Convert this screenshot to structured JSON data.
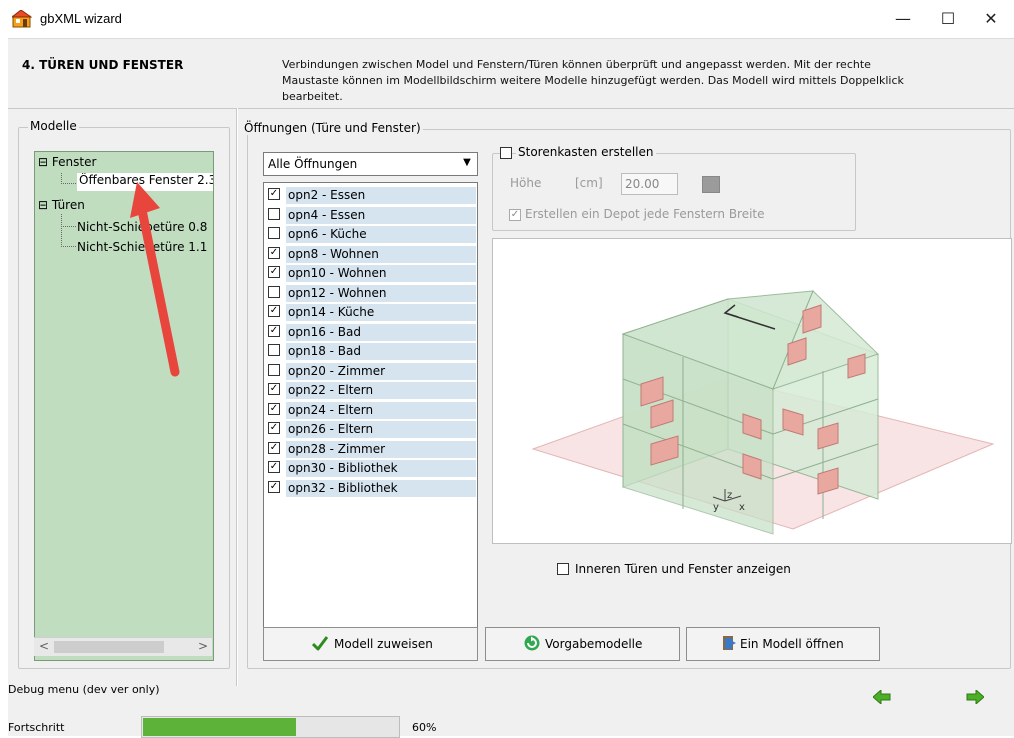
{
  "window": {
    "title": "gbXML wizard",
    "controls": {
      "minimize": "—",
      "maximize": "☐",
      "close": "✕"
    }
  },
  "step": {
    "title": "4.  TÜREN UND FENSTER",
    "description": "Verbindungen zwischen Model und Fenstern/Türen können überprüft und angepasst werden. Mit der rechte Maustaste können im Modellbildschirm weitere Modelle hinzugefügt werden. Das Modell wird mittels Doppelklick bearbeitet."
  },
  "modelle": {
    "label": "Modelle",
    "tree": [
      {
        "label": "Fenster",
        "expander": "⊟",
        "level": 0
      },
      {
        "label": "Öffenbares Fenster 2.3",
        "level": 1,
        "selected": true
      },
      {
        "label": "Türen",
        "expander": "⊟",
        "level": 0
      },
      {
        "label": "Nicht-Schiebetüre 0.8",
        "level": 1
      },
      {
        "label": "Nicht-Schiebetüre 1.1",
        "level": 1
      }
    ],
    "scroll_left": "<",
    "scroll_right": ">"
  },
  "oeffnungen": {
    "label": "Öffnungen (Türe und Fenster)",
    "filter": {
      "selected": "Alle Öffnungen"
    },
    "items": [
      {
        "label": "opn2 - Essen",
        "checked": true
      },
      {
        "label": "opn4 - Essen",
        "checked": false
      },
      {
        "label": "opn6 - Küche",
        "checked": false
      },
      {
        "label": "opn8 - Wohnen",
        "checked": true
      },
      {
        "label": "opn10 - Wohnen",
        "checked": true
      },
      {
        "label": "opn12 - Wohnen",
        "checked": false
      },
      {
        "label": "opn14 - Küche",
        "checked": true
      },
      {
        "label": "opn16 - Bad",
        "checked": true
      },
      {
        "label": "opn18 - Bad",
        "checked": false
      },
      {
        "label": "opn20 - Zimmer",
        "checked": false
      },
      {
        "label": "opn22 - Eltern",
        "checked": true
      },
      {
        "label": "opn24 - Eltern",
        "checked": true
      },
      {
        "label": "opn26 - Eltern",
        "checked": true
      },
      {
        "label": "opn28 - Zimmer",
        "checked": true
      },
      {
        "label": "opn30 - Bibliothek",
        "checked": true
      },
      {
        "label": "opn32 - Bibliothek",
        "checked": true
      }
    ]
  },
  "storenkasten": {
    "label": "Storenkasten erstellen",
    "checked": false,
    "hoehe_label": "Höhe",
    "unit": "[cm]",
    "hoehe_value": "20.00",
    "depot_label": "Erstellen ein Depot jede Fenstern Breite",
    "depot_checked": true
  },
  "preview": {
    "axis_y": "y",
    "axis_z": "z",
    "axis_x": "x"
  },
  "inner_toggle": {
    "label": "Inneren Türen und Fenster anzeigen",
    "checked": false
  },
  "buttons": {
    "assign": "Modell zuweisen",
    "defaults": "Vorgabemodelle",
    "open": "Ein Modell öffnen"
  },
  "footer": {
    "debug": "Debug menu (dev ver only)",
    "progress_label": "Fortschritt",
    "progress_value": 0.6,
    "progress_text": "60%"
  },
  "colors": {
    "tree_bg": "#c1ddc0",
    "list_selection": "#d6e4f0",
    "progress": "#5db33a",
    "nav_arrow": "#4caf28"
  }
}
